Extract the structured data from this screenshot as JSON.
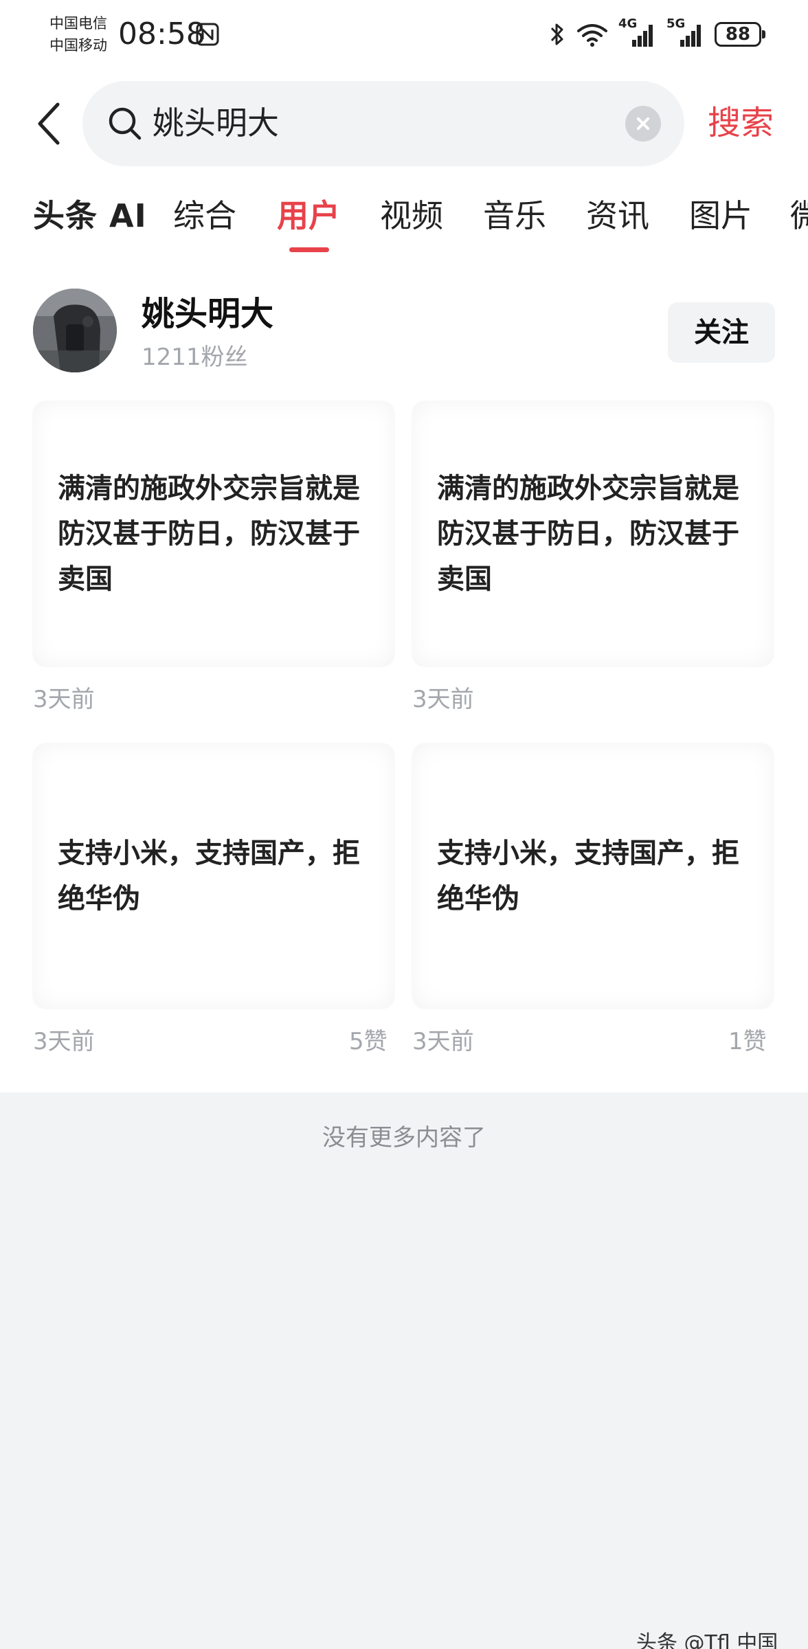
{
  "status_bar": {
    "carrier_1": "中国电信",
    "carrier_2": "中国移动",
    "time": "08:58",
    "network_1": "4G",
    "network_2": "5G",
    "battery": "88"
  },
  "search": {
    "query": "姚头明大",
    "submit_label": "搜索"
  },
  "tabs": [
    {
      "label": "头条 AI"
    },
    {
      "label": "综合"
    },
    {
      "label": "用户",
      "active": true
    },
    {
      "label": "视频"
    },
    {
      "label": "音乐"
    },
    {
      "label": "资讯"
    },
    {
      "label": "图片"
    },
    {
      "label": "微"
    }
  ],
  "user": {
    "name": "姚头明大",
    "fans": "1211粉丝",
    "follow_label": "关注"
  },
  "posts": [
    {
      "text": "满清的施政外交宗旨就是防汉甚于防日，防汉甚于卖国",
      "time": "3天前",
      "likes": ""
    },
    {
      "text": "满清的施政外交宗旨就是防汉甚于防日，防汉甚于卖国",
      "time": "3天前",
      "likes": ""
    },
    {
      "text": "支持小米，支持国产，拒绝华伪",
      "time": "3天前",
      "likes": "5赞"
    },
    {
      "text": "支持小米，支持国产，拒绝华伪",
      "time": "3天前",
      "likes": "1赞"
    }
  ],
  "end_message": "没有更多内容了",
  "watermark": "头条 @Tfl  中国",
  "colors": {
    "accent": "#e8424a",
    "muted_text": "#a3a6ab",
    "search_bg": "#f2f3f5",
    "page_bottom_bg": "#f2f3f5"
  }
}
